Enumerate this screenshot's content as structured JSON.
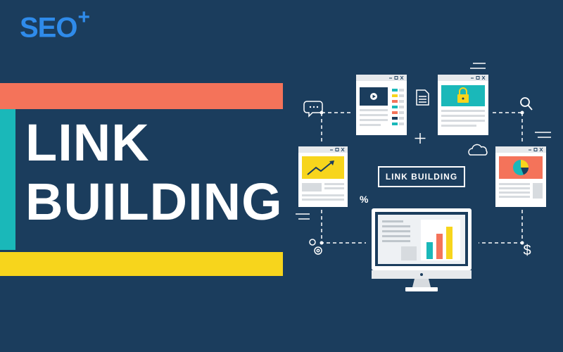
{
  "brand": {
    "logo_text": "SEO",
    "logo_sup": "+"
  },
  "headline": {
    "line1": "LINK",
    "line2": "BUILDING"
  },
  "center_label": "LINK BUILDING",
  "percent_symbol": "%",
  "colors": {
    "background": "#1b3d5d",
    "orange_bar": "#f4735a",
    "teal_bar": "#1ab8b9",
    "yellow_bar": "#f7d51c",
    "logo": "#2f8bea"
  },
  "icons": [
    "chat-bubble-icon",
    "document-icon",
    "search-icon",
    "cloud-icon",
    "plus-icon",
    "gear-icon",
    "dollar-icon",
    "lock-icon",
    "play-icon",
    "pie-chart-icon",
    "trend-chart-icon",
    "bar-chart-icon",
    "monitor-icon"
  ]
}
